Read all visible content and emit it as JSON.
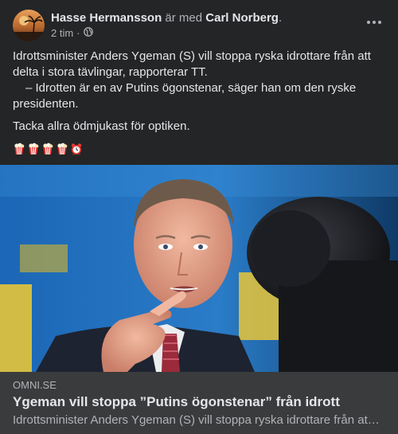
{
  "post": {
    "author": "Hasse Hermansson",
    "with_word": "är med",
    "tagged": "Carl Norberg",
    "tagged_suffix": ".",
    "time": "2 tim",
    "separator": "·",
    "privacy_icon": "globe-icon",
    "menu_icon": "more-horizontal-icon",
    "paragraphs": [
      "Idrottsminister Anders Ygeman (S) vill stoppa ryska idrottare från att delta i stora tävlingar, rapporterar TT.",
      "– Idrotten är en av Putins ögonstenar, säger han om den ryske presidenten.",
      "Tacka allra ödmjukast för optiken."
    ],
    "emojis": [
      "popcorn",
      "popcorn",
      "popcorn",
      "popcorn",
      "alarm-clock"
    ]
  },
  "link": {
    "domain": "OMNI.SE",
    "title": "Ygeman vill stoppa ”Putins ögonstenar” från idrott",
    "description": "Idrottsminister Anders Ygeman (S) vill stoppa ryska idrottare från att delta i stora tävlingar, rapporterar TT."
  },
  "colors": {
    "background": "#242526",
    "link_card": "#3a3b3c",
    "primary_text": "#e4e6eb",
    "secondary_text": "#b0b3b8"
  }
}
